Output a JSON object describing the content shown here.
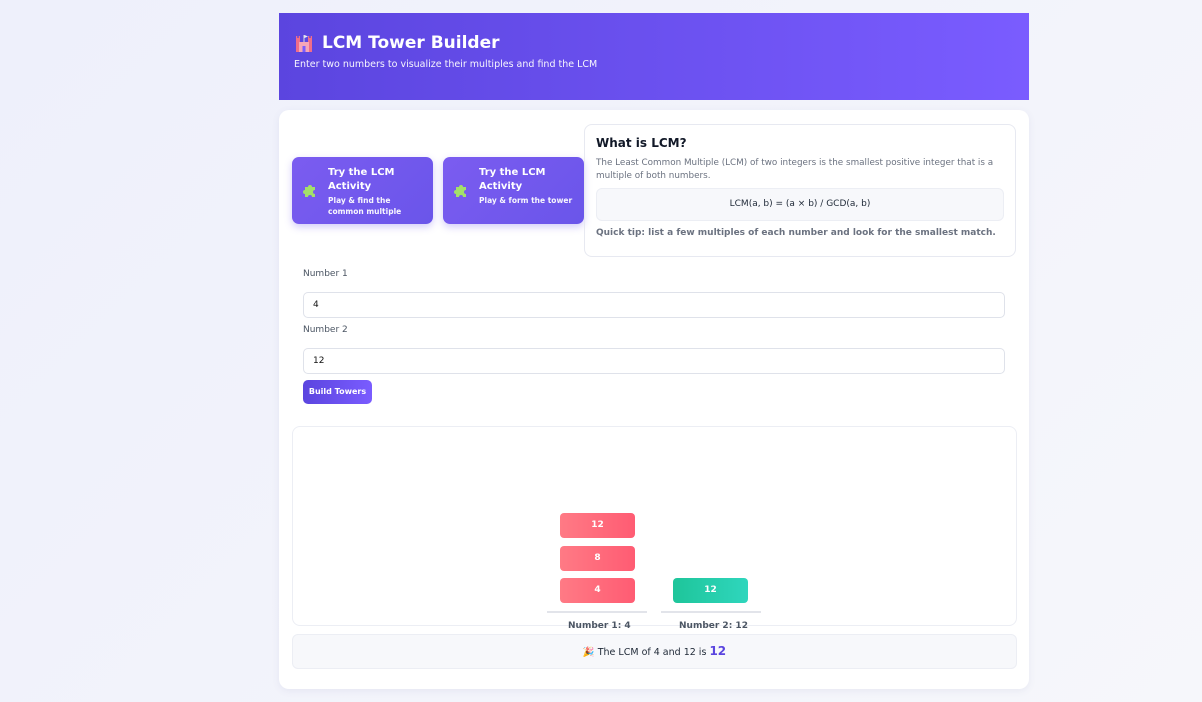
{
  "header": {
    "title": "LCM Tower Builder",
    "subtitle": "Enter two numbers to visualize their multiples and find the LCM"
  },
  "activities": [
    {
      "title": "Try the LCM Activity",
      "subtitle": "Play & find the common multiple"
    },
    {
      "title": "Try the LCM Activity",
      "subtitle": "Play & form the tower"
    }
  ],
  "info": {
    "title": "What is LCM?",
    "text": "The Least Common Multiple (LCM) of two integers is the smallest positive integer that is a multiple of both numbers.",
    "formula": "LCM(a, b) = (a × b) / GCD(a, b)",
    "tip": "Quick tip: list a few multiples of each number and look for the smallest match."
  },
  "form": {
    "number1_label": "Number 1",
    "number1_value": "4",
    "number2_label": "Number 2",
    "number2_value": "12",
    "build_label": "Build Towers"
  },
  "towers": {
    "tower1": {
      "blocks": [
        "12",
        "8",
        "4"
      ],
      "label": "Number 1: 4"
    },
    "tower2": {
      "blocks": [
        "12"
      ],
      "label": "Number 2: 12"
    }
  },
  "result": {
    "emoji": "🎉",
    "text": "The LCM of 4 and 12 is",
    "value": "12"
  },
  "colors": {
    "accent": "#6a55ea",
    "tower1": "#ff6b7c",
    "tower2": "#22cfa8"
  }
}
